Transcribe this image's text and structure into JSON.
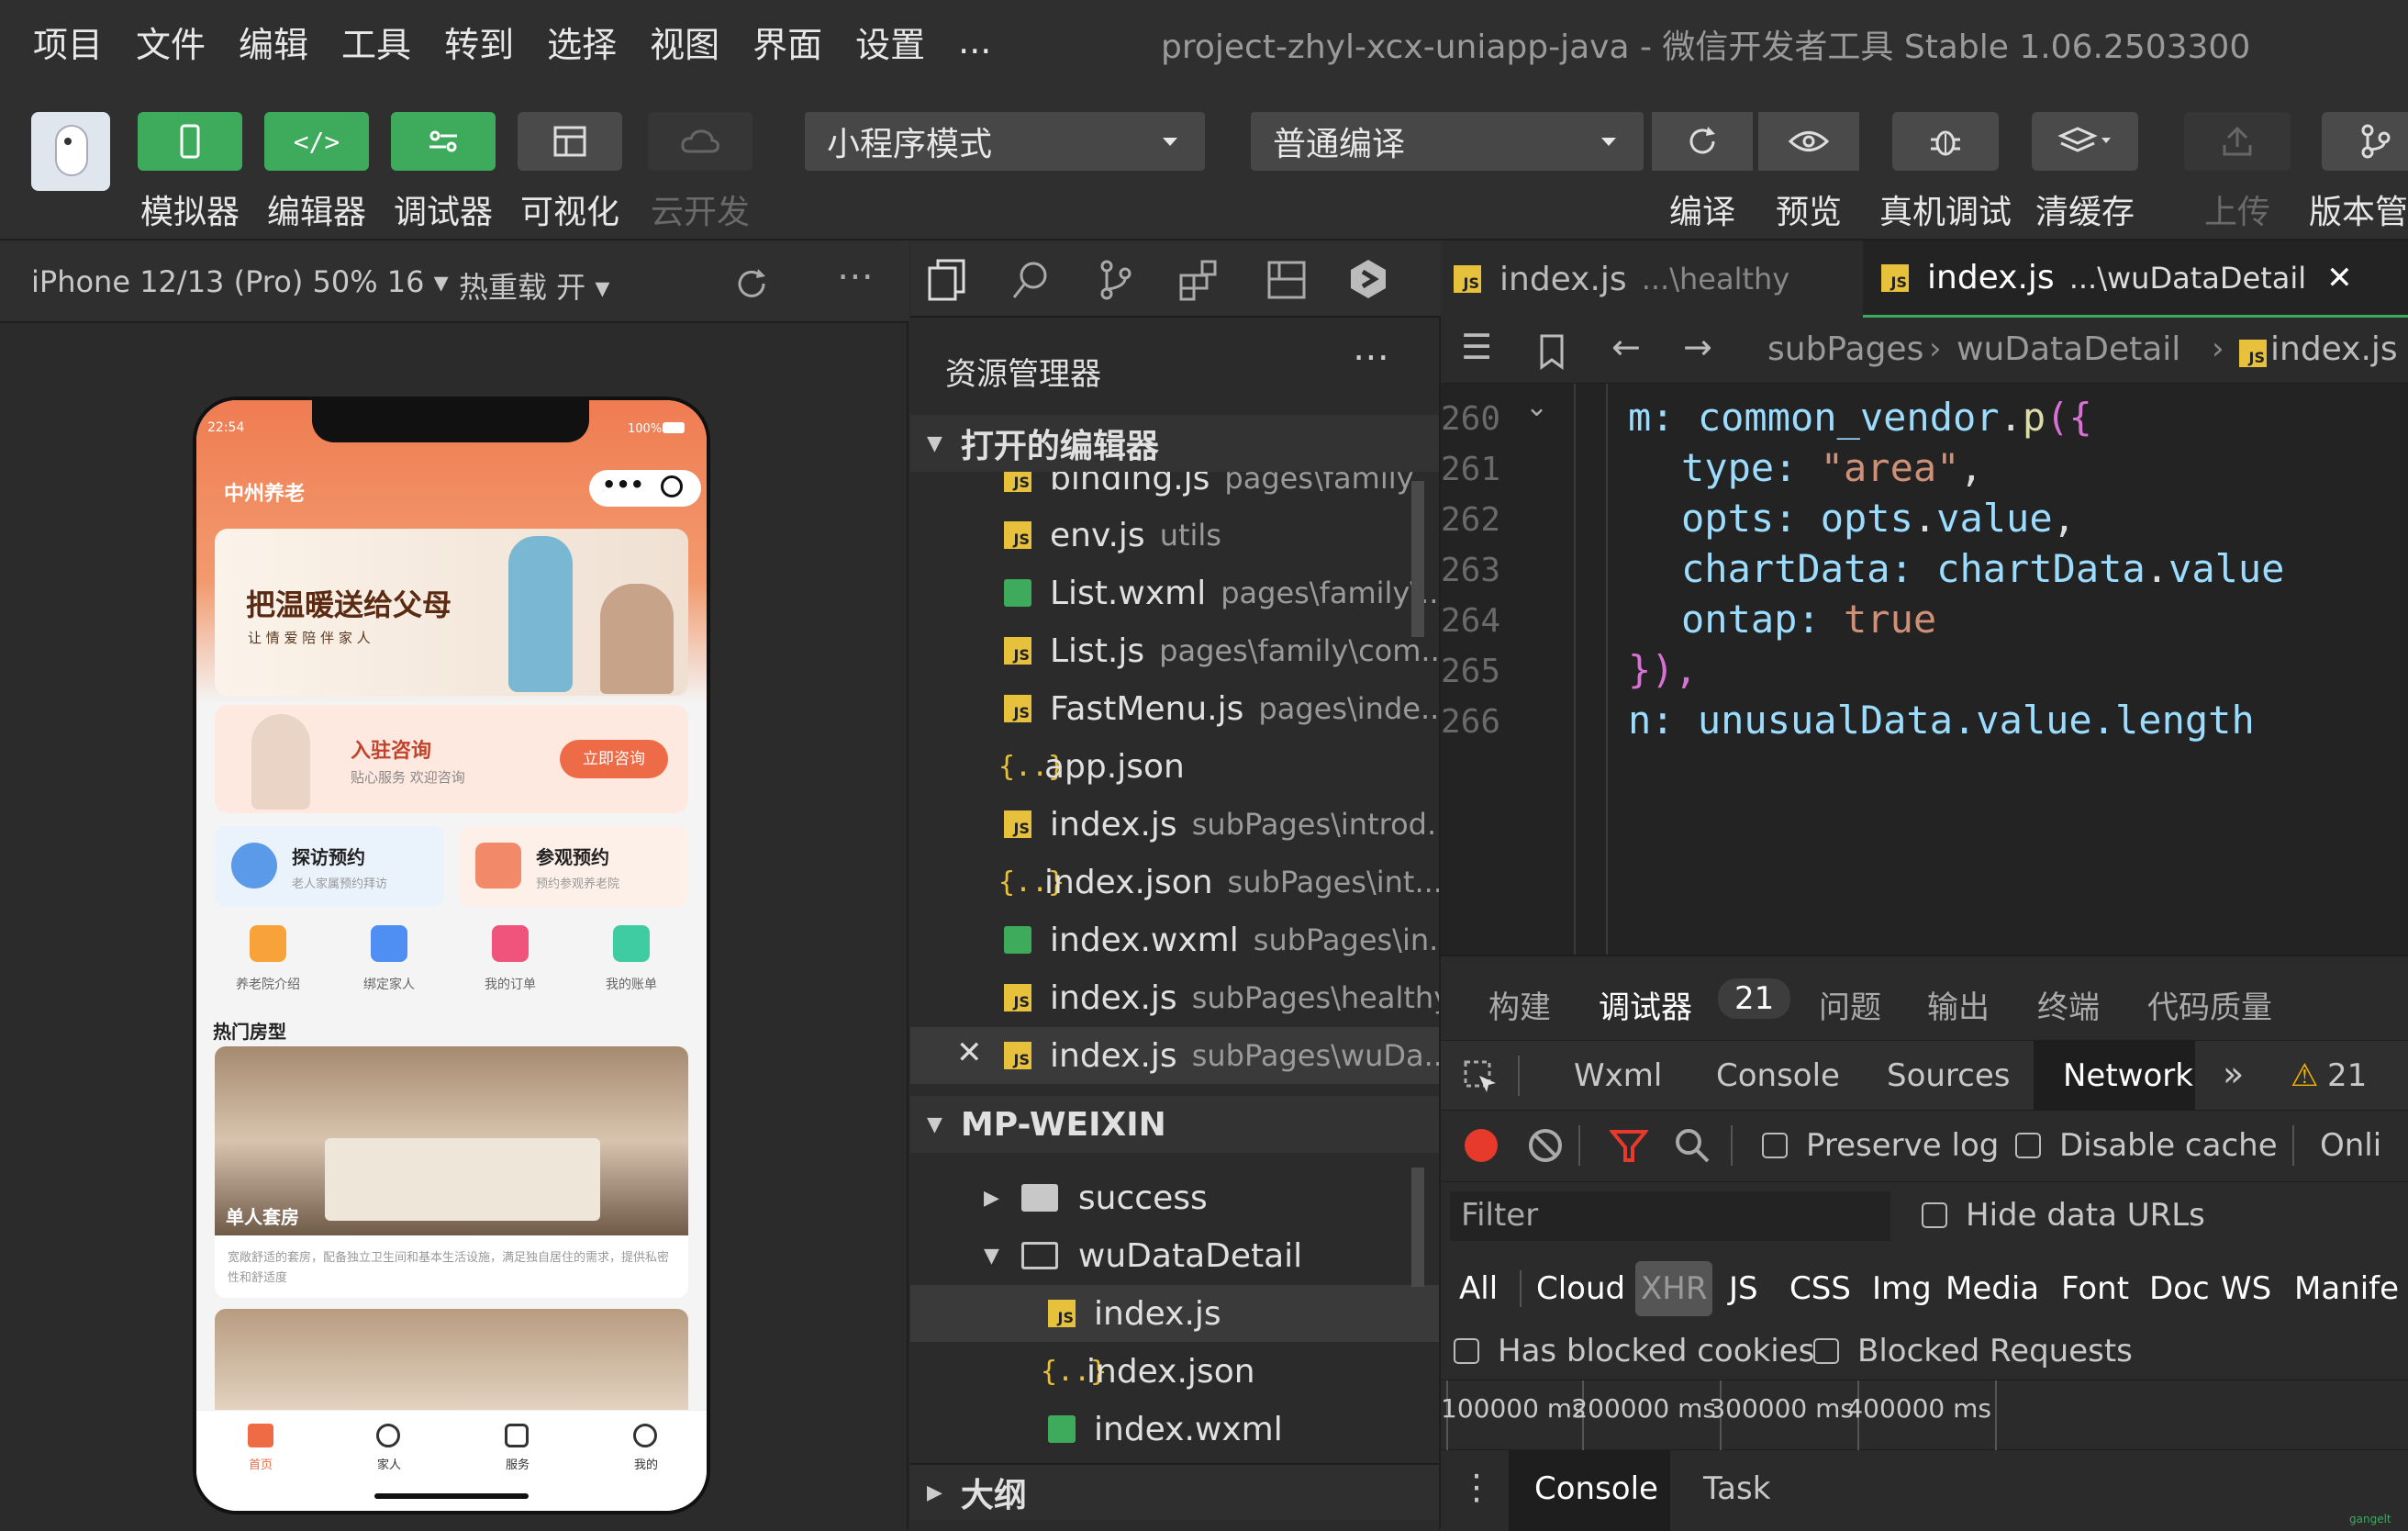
{
  "menu": [
    "项目",
    "文件",
    "编辑",
    "工具",
    "转到",
    "选择",
    "视图",
    "界面",
    "设置",
    "..."
  ],
  "window_title": "project-zhyl-xcx-uniapp-java - 微信开发者工具 Stable 1.06.2503300",
  "toolbar": {
    "simulator": "模拟器",
    "editor": "编辑器",
    "debugger": "调试器",
    "visual": "可视化",
    "cloud": "云开发",
    "mode_select": "小程序模式",
    "compile_select": "普通编译",
    "compile": "编译",
    "preview": "预览",
    "device_debug": "真机调试",
    "clear_cache": "清缓存",
    "upload": "上传",
    "version": "版本管"
  },
  "sim_bar": {
    "device": "iPhone 12/13 (Pro) 50% 16",
    "hot_reload": "热重载 开"
  },
  "phone": {
    "time": "22:54",
    "battery": "100%",
    "app_name": "中州养老",
    "banner_title": "把温暖送给父母",
    "banner_sub": "让 情 爱 陪 伴 家 人",
    "consult_title": "入驻咨询",
    "consult_sub": "贴心服务 欢迎咨询",
    "consult_btn": "立即咨询",
    "card1_title": "探访预约",
    "card1_sub": "老人家属预约拜访",
    "card2_title": "参观预约",
    "card2_sub": "预约参观养老院",
    "icons": [
      "养老院介绍",
      "绑定家人",
      "我的订单",
      "我的账单"
    ],
    "section_title": "热门房型",
    "room_name": "单人套房",
    "room_desc": "宽敞舒适的套房，配备独立卫生间和基本生活设施，满足独自居住的需求，提供私密性和舒适度",
    "tabs": [
      "首页",
      "家人",
      "服务",
      "我的"
    ]
  },
  "explorer": {
    "title": "资源管理器",
    "open_editors": "打开的编辑器",
    "open_files": [
      {
        "name": "binding.js",
        "path": "pages\\family",
        "type": "js"
      },
      {
        "name": "env.js",
        "path": "utils",
        "type": "js"
      },
      {
        "name": "List.wxml",
        "path": "pages\\family\\...",
        "type": "wxml"
      },
      {
        "name": "List.js",
        "path": "pages\\family\\com...",
        "type": "js"
      },
      {
        "name": "FastMenu.js",
        "path": "pages\\inde...",
        "type": "js"
      },
      {
        "name": "app.json",
        "path": "",
        "type": "json"
      },
      {
        "name": "index.js",
        "path": "subPages\\introd...",
        "type": "js"
      },
      {
        "name": "index.json",
        "path": "subPages\\int...",
        "type": "json"
      },
      {
        "name": "index.wxml",
        "path": "subPages\\in...",
        "type": "wxml"
      },
      {
        "name": "index.js",
        "path": "subPages\\healthy",
        "type": "js"
      },
      {
        "name": "index.js",
        "path": "subPages\\wuDa...",
        "type": "js"
      }
    ],
    "project": "MP-WEIXIN",
    "tree": [
      {
        "name": "success",
        "kind": "folder"
      },
      {
        "name": "wuDataDetail",
        "kind": "folder-open"
      },
      {
        "name": "index.js",
        "kind": "js"
      },
      {
        "name": "index.json",
        "kind": "json"
      },
      {
        "name": "index.wxml",
        "kind": "wxml"
      }
    ],
    "outline": "大纲"
  },
  "editor": {
    "tab1_name": "index.js",
    "tab1_path": "...\\healthy",
    "tab2_name": "index.js",
    "tab2_path": "...\\wuDataDetail",
    "breadcrumb": [
      "subPages",
      "wuDataDetail",
      "index.js"
    ],
    "line_numbers": [
      "260",
      "261",
      "262",
      "263",
      "264",
      "265",
      "266"
    ],
    "code_lines": [
      [
        "m: ",
        "common_vendor",
        ".",
        "p",
        "({"
      ],
      [
        "type: ",
        "\"area\"",
        ","
      ],
      [
        "opts: ",
        "opts",
        ".",
        "value",
        ","
      ],
      [
        "chartData: ",
        "chartData",
        ".",
        "value"
      ],
      [
        "ontap: ",
        "true"
      ],
      [
        "}),"
      ],
      [
        "n: unusualData.value.length"
      ]
    ]
  },
  "devtools": {
    "panel_tabs": [
      "构建",
      "调试器",
      "21",
      "问题",
      "输出",
      "终端",
      "代码质量"
    ],
    "tabs": [
      "Wxml",
      "Console",
      "Sources",
      "Network",
      "»",
      "21"
    ],
    "preserve_log": "Preserve log",
    "disable_cache": "Disable cache",
    "online": "Onli",
    "filter_placeholder": "Filter",
    "hide_data_urls": "Hide data URLs",
    "types": [
      "All",
      "Cloud",
      "XHR",
      "JS",
      "CSS",
      "Img",
      "Media",
      "Font",
      "Doc",
      "WS",
      "Manife"
    ],
    "blocked_cookies": "Has blocked cookies",
    "blocked_requests": "Blocked Requests",
    "timeline": [
      "100000 ms",
      "200000 ms",
      "300000 ms",
      "400000 ms"
    ],
    "drawer_tabs": [
      "Console",
      "Task"
    ],
    "corner": "gangelt"
  },
  "colors": {
    "accent_green": "#3daa5c",
    "phone_orange": "#f07c52",
    "js_yellow": "#e8c13c"
  }
}
